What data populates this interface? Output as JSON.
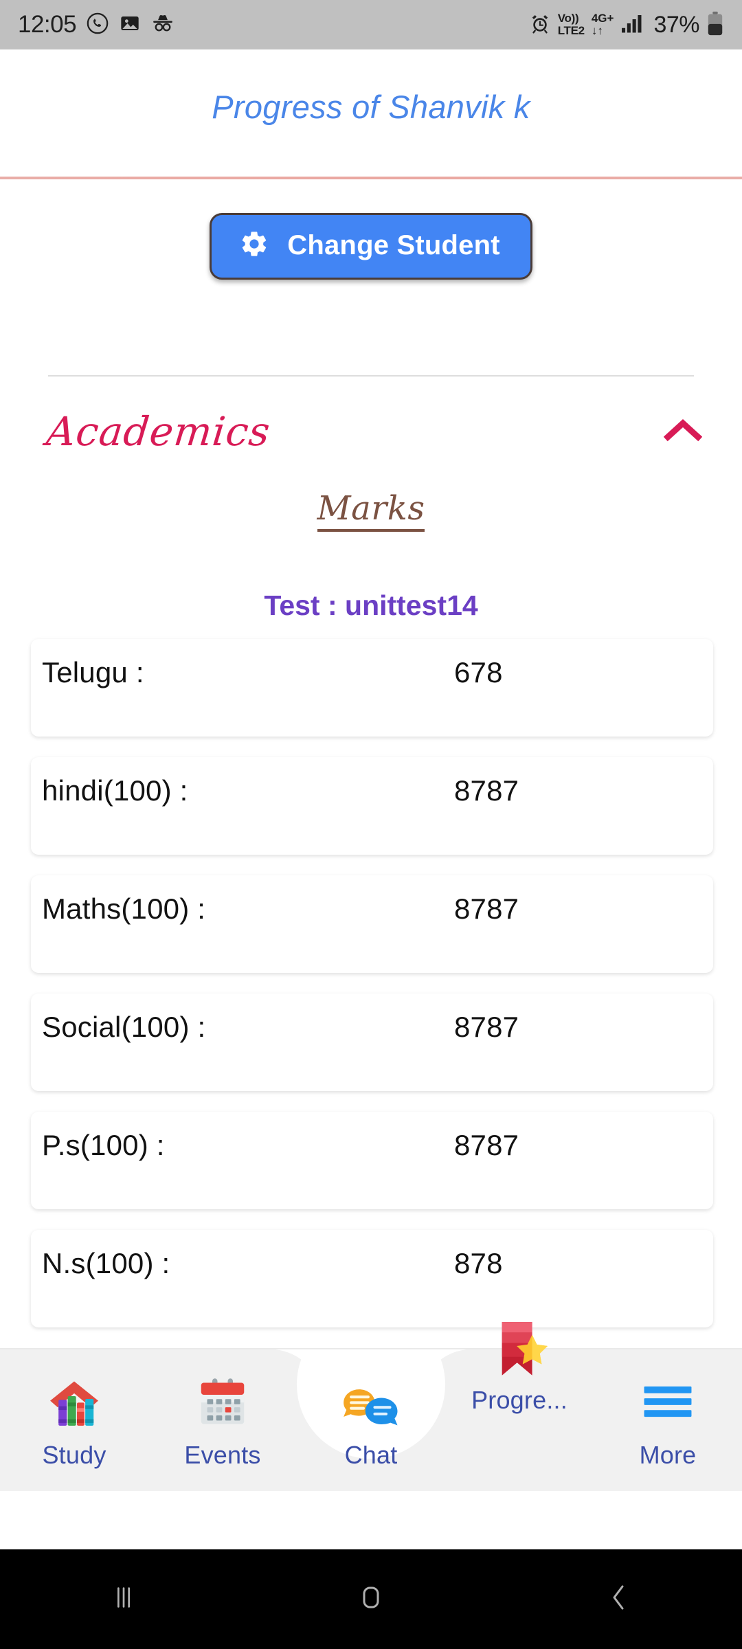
{
  "statusbar": {
    "time": "12:05",
    "icons_left": [
      "whatsapp-call-icon",
      "gallery-icon",
      "incognito-icon"
    ],
    "alarm_icon": "alarm-icon",
    "volte_line1": "Vo))",
    "volte_line2": "LTE2",
    "network_line1": "4G+",
    "network_line2": "↓↑",
    "signal_icon": "signal-bars-icon",
    "battery_percent": "37%",
    "battery_icon": "battery-icon"
  },
  "header": {
    "title": "Progress of Shanvik k",
    "title_color": "#4a86e8",
    "rule_color": "#e8a9a3"
  },
  "change_student": {
    "label": "Change Student",
    "icon": "gear-icon",
    "bg_color": "#4285f4"
  },
  "academics": {
    "title": "Academics",
    "title_color": "#d81b56",
    "collapse_icon": "chevron-up-icon",
    "expanded": "true"
  },
  "marks": {
    "heading": "Marks",
    "heading_color": "#7b5242",
    "test_label": "Test : unittest14",
    "test_color": "#6b3fc4",
    "rows": [
      {
        "subject": "Telugu :",
        "score": "678"
      },
      {
        "subject": "hindi(100) :",
        "score": "8787"
      },
      {
        "subject": "Maths(100) :",
        "score": "8787"
      },
      {
        "subject": "Social(100) :",
        "score": "8787"
      },
      {
        "subject": "P.s(100) :",
        "score": "8787"
      },
      {
        "subject": "N.s(100) :",
        "score": "878"
      }
    ]
  },
  "bottom_nav": {
    "label_color": "#3b4ea8",
    "items": [
      {
        "label": "Study",
        "icon": "study-books-house-icon",
        "active": "false"
      },
      {
        "label": "Events",
        "icon": "calendar-icon",
        "active": "false"
      },
      {
        "label": "Chat",
        "icon": "chat-bubbles-icon",
        "active": "false"
      },
      {
        "label": "Progre...",
        "icon": "bookmark-star-icon",
        "active": "true"
      },
      {
        "label": "More",
        "icon": "hamburger-menu-icon",
        "active": "false"
      }
    ]
  },
  "system_nav": {
    "recents": "recents-icon",
    "home": "home-icon",
    "back": "back-icon"
  }
}
